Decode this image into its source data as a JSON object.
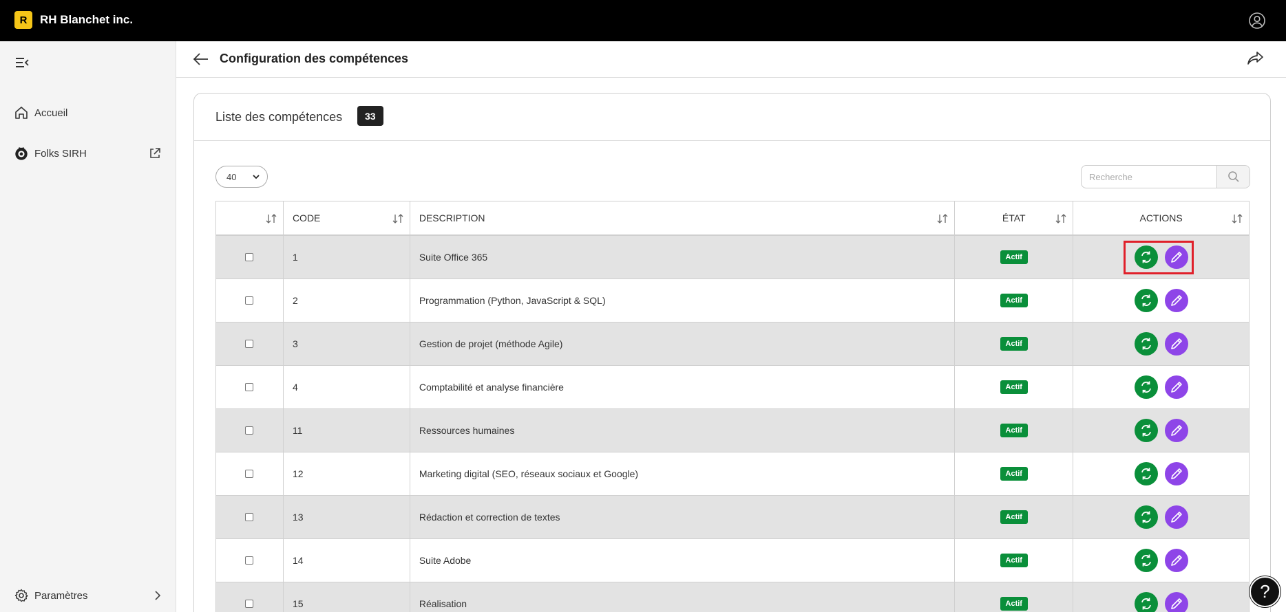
{
  "app": {
    "logo_letter": "R",
    "company": "RH Blanchet inc."
  },
  "sidebar": {
    "items": [
      {
        "label": "Accueil",
        "icon": "home-icon"
      },
      {
        "label": "Folks SIRH",
        "icon": "folks-logo-icon"
      }
    ],
    "footer": {
      "label": "Paramètres",
      "icon": "gear-icon"
    }
  },
  "page": {
    "title": "Configuration des compétences"
  },
  "card": {
    "title": "Liste des compétences",
    "count": "33"
  },
  "controls": {
    "page_size": "40",
    "search_placeholder": "Recherche"
  },
  "table": {
    "columns": [
      "",
      "CODE",
      "DESCRIPTION",
      "ÉTAT",
      "ACTIONS"
    ],
    "rows": [
      {
        "code": "1",
        "description": "Suite Office 365",
        "state": "Actif"
      },
      {
        "code": "2",
        "description": "Programmation (Python, JavaScript & SQL)",
        "state": "Actif"
      },
      {
        "code": "3",
        "description": "Gestion de projet (méthode Agile)",
        "state": "Actif"
      },
      {
        "code": "4",
        "description": "Comptabilité et analyse financière",
        "state": "Actif"
      },
      {
        "code": "11",
        "description": "Ressources humaines",
        "state": "Actif"
      },
      {
        "code": "12",
        "description": "Marketing digital (SEO, réseaux sociaux et Google)",
        "state": "Actif"
      },
      {
        "code": "13",
        "description": "Rédaction et correction de textes",
        "state": "Actif"
      },
      {
        "code": "14",
        "description": "Suite Adobe",
        "state": "Actif"
      },
      {
        "code": "15",
        "description": "Réalisation",
        "state": "Actif"
      }
    ]
  },
  "colors": {
    "topbar": "#000000",
    "logo": "#f5c518",
    "status_active": "#0a8f3a",
    "edit_button": "#8e45e8",
    "highlight": "#e0202a"
  },
  "help": {
    "label": "?"
  }
}
